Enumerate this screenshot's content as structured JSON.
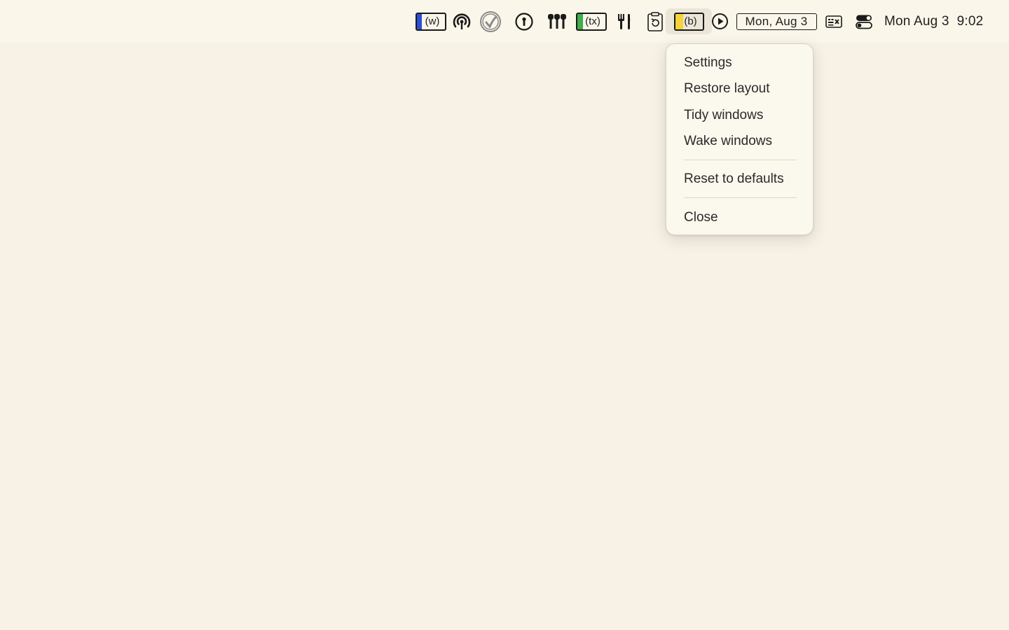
{
  "menubar": {
    "items": {
      "w_box": {
        "label": "(w)",
        "icon": "w-box-icon",
        "fill_color": "#2d4fd6"
      },
      "broadcast": {
        "icon": "broadcast-icon"
      },
      "check_circle": {
        "icon": "check-circle-icon"
      },
      "password": {
        "icon": "password-keyhole-icon"
      },
      "microphone_stand": {
        "icon": "microphone-stand-icon"
      },
      "tx_box": {
        "label": "(tx)",
        "icon": "tx-box-icon",
        "fill_color": "#3fae4e"
      },
      "utensils": {
        "icon": "fork-knife-icon"
      },
      "clipboard_refresh": {
        "icon": "clipboard-refresh-icon"
      },
      "b_box": {
        "label": "(b)",
        "icon": "b-box-icon",
        "fill_color": "#f5d33b",
        "active": true
      },
      "play": {
        "icon": "play-circle-icon"
      },
      "date_box": {
        "label": "Mon, Aug 3"
      },
      "keyboard": {
        "icon": "keyboard-panel-icon"
      },
      "control_center": {
        "icon": "control-center-icon"
      },
      "clock": {
        "day": "Mon Aug 3",
        "time": "9:02"
      }
    }
  },
  "dropdown": {
    "items": [
      {
        "label": "Settings"
      },
      {
        "label": "Restore layout"
      },
      {
        "label": "Tidy windows"
      },
      {
        "label": "Wake windows"
      },
      {
        "label": "Reset to defaults"
      },
      {
        "label": "Close"
      }
    ]
  }
}
